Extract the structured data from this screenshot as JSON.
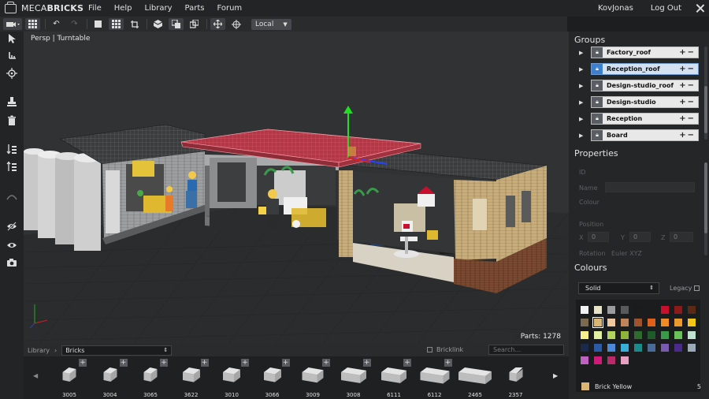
{
  "app": {
    "logo_text_light": "MECA",
    "logo_text_bold": "BRICKS"
  },
  "menu": [
    "File",
    "Help",
    "Library",
    "Parts",
    "Forum"
  ],
  "user": {
    "name": "KovJonas",
    "logout": "Log Out"
  },
  "toolbar": {
    "space_mode": "Local"
  },
  "viewport": {
    "mode_label": "Persp | Turntable",
    "parts_label": "Parts: 1278"
  },
  "groups": {
    "title": "Groups",
    "items": [
      {
        "name": "Factory_roof",
        "selected": false
      },
      {
        "name": "Reception_roof",
        "selected": true
      },
      {
        "name": "Design-studio_roof",
        "selected": false
      },
      {
        "name": "Design-studio",
        "selected": false
      },
      {
        "name": "Reception",
        "selected": false
      },
      {
        "name": "Board",
        "selected": false
      }
    ]
  },
  "properties": {
    "title": "Properties",
    "id_label": "ID",
    "name_label": "Name",
    "colour_label": "Colour",
    "position_label": "Position",
    "x_label": "X",
    "y_label": "Y",
    "z_label": "Z",
    "x_value": "0",
    "y_value": "0",
    "z_value": "0",
    "rotation_label": "Rotation",
    "rotation_value": "Euler XYZ"
  },
  "colours": {
    "title": "Colours",
    "type": "Solid",
    "legacy_label": "Legacy",
    "selected_name": "Brick Yellow",
    "selected_count": "5",
    "selected_hex": "#d9b673",
    "palette": [
      "#f2f2f2",
      "#e6e3c8",
      "#9c9c9c",
      "#5a5a5a",
      "#1b1b1b",
      "#1c1c1c",
      "#c8102e",
      "#8b1a1a",
      "#5a2a17",
      "#7a6a50",
      "#d9b673",
      "#f0c8a0",
      "#c0845b",
      "#a0522d",
      "#e0601b",
      "#f08a24",
      "#e89a2e",
      "#f5c518",
      "#f5f08c",
      "#e2f0a0",
      "#b5d35f",
      "#8db33a",
      "#2e6b2e",
      "#1e5a2a",
      "#3a9a4a",
      "#6ac05a",
      "#bfe3d0",
      "#1b2a4a",
      "#2a5aa8",
      "#4a8ad8",
      "#3ab0d8",
      "#1a8a8a",
      "#4a6a9a",
      "#7a5ab0",
      "#4a2a8a",
      "#9aa8b8",
      "#c060c0",
      "#d01a7a",
      "#b82a6a",
      "#e8a0c0"
    ]
  },
  "library": {
    "label": "Library",
    "category": "Bricks",
    "bricklink_label": "Bricklink",
    "search_placeholder": "Search...",
    "items": [
      "3005",
      "3004",
      "3065",
      "3622",
      "3010",
      "3066",
      "3009",
      "3008",
      "6111",
      "6112",
      "2465",
      "2357"
    ]
  }
}
